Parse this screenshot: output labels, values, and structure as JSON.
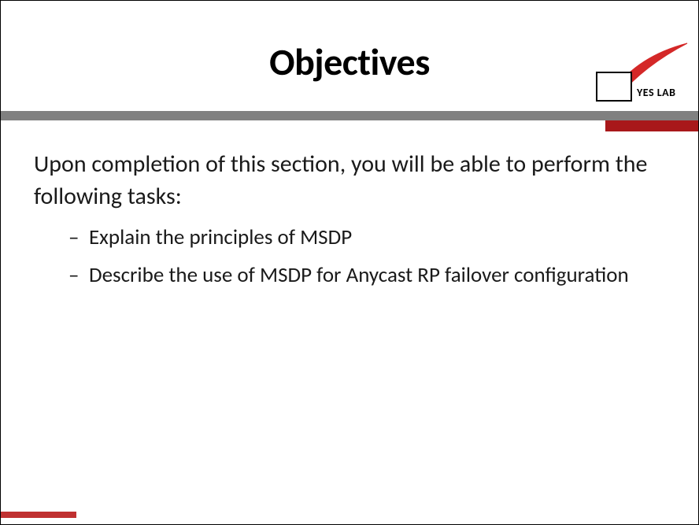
{
  "slide": {
    "title": "Objectives",
    "logo": {
      "text": "YES LAB"
    },
    "intro": "Upon completion of this section, you will be able to perform the following tasks:",
    "bullets": [
      "Explain the principles of MSDP",
      "Describe the use of MSDP for Anycast RP failover configuration"
    ]
  },
  "colors": {
    "accent_red": "#a8181a",
    "divider_gray": "#808080",
    "check_red": "#d42828"
  }
}
